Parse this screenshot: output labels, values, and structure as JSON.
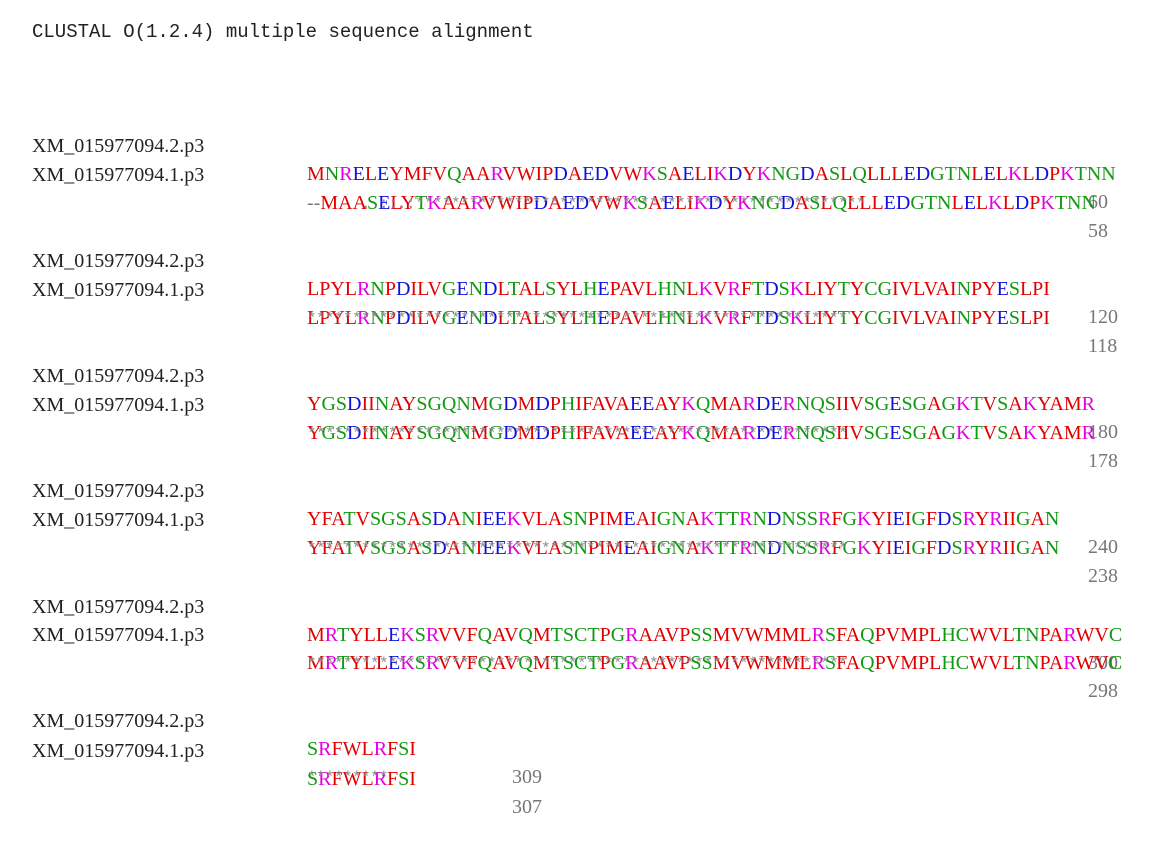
{
  "title": "CLUSTAL O(1.2.4) multiple sequence alignment",
  "blocks": [
    {
      "rows": [
        {
          "name": "XM_015977094.2.p3",
          "seq": "MNRELEYMFVQAARVWIPDAEDVWKSAELIKDYKNGDASLQLLLEDGTNLELKLDPKTNN",
          "num": "60"
        },
        {
          "name": "XM_015977094.1.p3",
          "seq": "--MAASELYTKAARVWIPDAEDVWKSAELIKDYKNGDASLQLLLEDGTNLELKLDPKTNN",
          "num": "58"
        }
      ],
      "consensus": "      . ::.:**************************************************"
    },
    {
      "rows": [
        {
          "name": "XM_015977094.2.p3",
          "seq": "LPYLRNPDILVGENDLTALSYLHEPAVLHNLKVRFTDSKLIYTYCGIVLVAINPYESLPI",
          "num": "120"
        },
        {
          "name": "XM_015977094.1.p3",
          "seq": "LPYLRNPDILVGENDLTALSYLHEPAVLHNLKVRFTDSKLIYTYCGIVLVAINPYESLPI",
          "num": "118"
        }
      ],
      "consensus": "************************************************************"
    },
    {
      "rows": [
        {
          "name": "XM_015977094.2.p3",
          "seq": "YGSDIINAYSGQNMGDMDPHIFAVAEEAYKQMARDERNQSIIVSGESGAGKTVSAKYAMR",
          "num": "180"
        },
        {
          "name": "XM_015977094.1.p3",
          "seq": "YGSDIINAYSGQNMGDMDPHIFAVAEEAYKQMARDERNQSIIVSGESGAGKTVSAKYAMR",
          "num": "178"
        }
      ],
      "consensus": "************************************************************"
    },
    {
      "rows": [
        {
          "name": "XM_015977094.2.p3",
          "seq": "YFATVSGSASDANIEEKVLASNPIMEAIGNAKTTRNDNSSRFGKYIEIGFDSRYRIIGAN",
          "num": "240"
        },
        {
          "name": "XM_015977094.1.p3",
          "seq": "YFATVSGSASDANIEEKVLASNPIMEAIGNAKTTRNDNSSRFGKYIEIGFDSRYRIIGAN",
          "num": "238"
        }
      ],
      "consensus": "************************************************************"
    },
    {
      "rows": [
        {
          "name": "XM_015977094.2.p3",
          "seq": "MRTYLLEKSRVVFQAVQMTSCTPGRAAVPSSMVWMMLRSFAQPVMPLHCWVLTNPARWVC",
          "num": "300"
        },
        {
          "name": "XM_015977094.1.p3",
          "seq": "MRTYLLEKSRVVFQAVQMTSCTPGRAAVPSSMVWMMLRSFAQPVMPLHCWVLTNPARWVC",
          "num": "298"
        }
      ],
      "consensus": "************************************************************"
    },
    {
      "rows": [
        {
          "name": "XM_015977094.2.p3",
          "seq": "SRFWLRFSI",
          "num": "309"
        },
        {
          "name": "XM_015977094.1.p3",
          "seq": "SRFWLRFSI",
          "num": "307"
        }
      ],
      "consensus": "*********"
    }
  ],
  "residue_colors": {
    "hydrophobic": "#e00000",
    "acidic": "#1010dd",
    "basic": "#e000e0",
    "polar": "#119911",
    "gap": "#777777"
  }
}
